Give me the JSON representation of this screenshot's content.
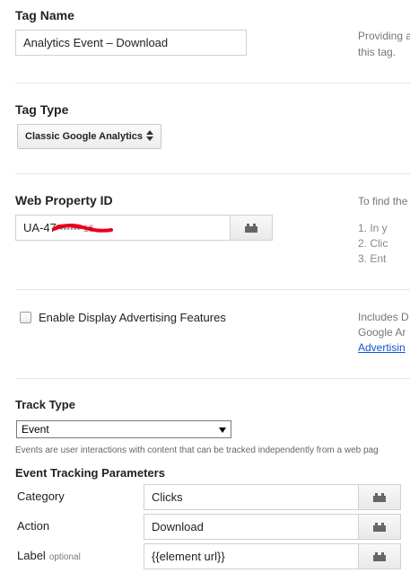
{
  "tag_name": {
    "label": "Tag Name",
    "value": "Analytics Event – Download",
    "help_line1": "Providing a",
    "help_line2": "this tag."
  },
  "tag_type": {
    "label": "Tag Type",
    "value": "Classic Google Analytics"
  },
  "web_property": {
    "label": "Web Property ID",
    "value_visible": "UA-47",
    "value_redacted": "•••••• 15",
    "help_title": "To find the",
    "steps": [
      "1.  In y",
      "2.  Clic",
      "3.  Ent"
    ]
  },
  "display_ads": {
    "label": "Enable Display Advertising Features",
    "checked": false,
    "help_line1": "Includes D",
    "help_line2": "Google Ar",
    "help_link": "Advertisin"
  },
  "track_type": {
    "label": "Track Type",
    "value": "Event",
    "help": "Events are user interactions with content that can be tracked independently from a web pag"
  },
  "event_params": {
    "title": "Event Tracking Parameters",
    "rows": [
      {
        "label": "Category",
        "optional": "",
        "value": "Clicks"
      },
      {
        "label": "Action",
        "optional": "",
        "value": "Download"
      },
      {
        "label": "Label",
        "optional": "optional",
        "value": "{{element url}}"
      }
    ]
  },
  "colors": {
    "divider": "#e5e5e5",
    "redaction": "#e8001c",
    "link": "#1155cc"
  },
  "icons": {
    "macro": "macro-brick-icon",
    "select_arrows": "up-down-arrows-icon",
    "dropdown": "caret-down-icon"
  }
}
